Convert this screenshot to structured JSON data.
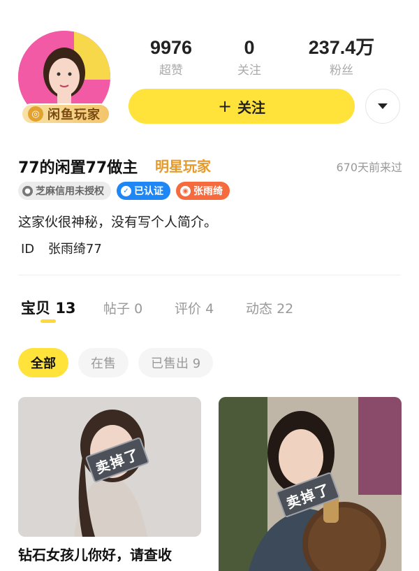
{
  "profile": {
    "badge_label": "闲鱼玩家",
    "stats": [
      {
        "value": "9976",
        "label": "超赞"
      },
      {
        "value": "0",
        "label": "关注"
      },
      {
        "value": "237.4万",
        "label": "粉丝"
      }
    ],
    "follow_label": "关注",
    "nickname": "77的闲置77做主",
    "title_tag": "明星玩家",
    "last_seen": "670天前来过",
    "tags": {
      "credit": "芝麻信用未授权",
      "verified": "已认证",
      "weibo": "张雨绮"
    },
    "bio": "这家伙很神秘，没有写个人简介。",
    "id_label": "ID",
    "id_value": "张雨绮77"
  },
  "tabs": [
    {
      "label": "宝贝",
      "count": "13"
    },
    {
      "label": "帖子",
      "count": "0"
    },
    {
      "label": "评价",
      "count": "4"
    },
    {
      "label": "动态",
      "count": "22"
    }
  ],
  "filters": [
    {
      "label": "全部"
    },
    {
      "label": "在售"
    },
    {
      "label": "已售出 9"
    }
  ],
  "items": [
    {
      "sold_label": "卖掉了",
      "title": "钻石女孩儿你好，请查收"
    },
    {
      "sold_label": "卖掉了"
    }
  ],
  "colors": {
    "accent_yellow": "#ffe23a",
    "verified_blue": "#1f86f5",
    "weibo_orange": "#f56b3d",
    "star_gold": "#e59a2c"
  },
  "icons": [
    "star-badge-icon",
    "plus-icon",
    "dropdown-icon",
    "credit-icon",
    "verified-icon",
    "weibo-icon"
  ]
}
